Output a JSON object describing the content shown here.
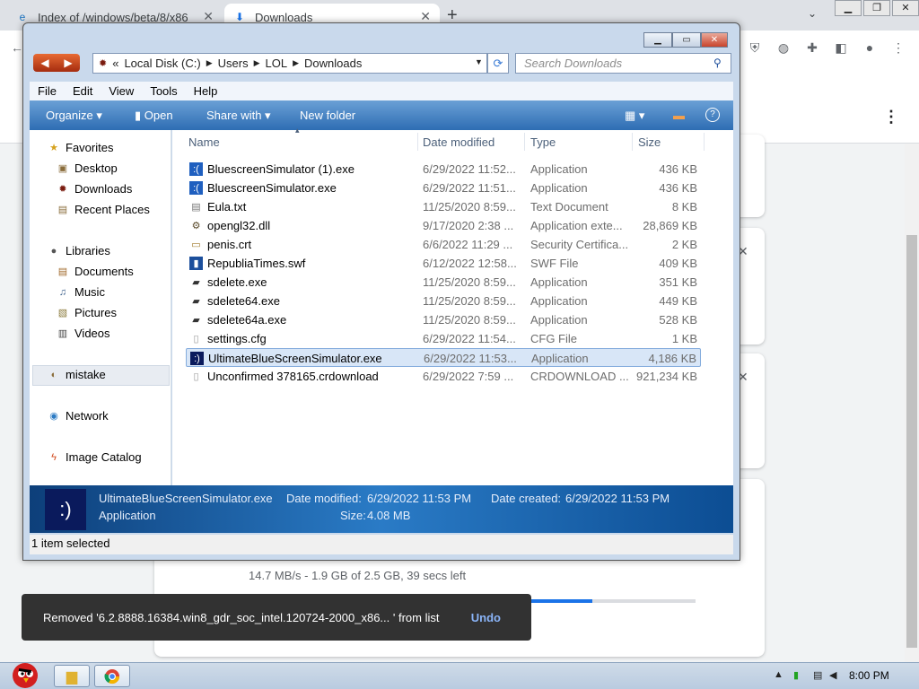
{
  "browser": {
    "tabs": [
      {
        "title": "Index of /windows/beta/8/x86"
      },
      {
        "title": "Downloads"
      }
    ],
    "new_tab_symbol": "+",
    "window_buttons": [
      "▁",
      "❐",
      "✕"
    ]
  },
  "downloads_page": {
    "progress_text": "14.7 MB/s - 1.9 GB of 2.5 GB, 39 secs left",
    "progress_fraction": 0.55,
    "snackbar": {
      "message": "Removed '6.2.8888.16384.win8_gdr_soc_intel.120724-2000_x86... ' from list",
      "action": "Undo"
    }
  },
  "explorer": {
    "breadcrumb": {
      "prefix": "«",
      "parts": [
        "Local Disk (C:)",
        "Users",
        "LOL",
        "Downloads"
      ]
    },
    "search_placeholder": "Search Downloads",
    "menu": [
      "File",
      "Edit",
      "View",
      "Tools",
      "Help"
    ],
    "commands": [
      "Organize",
      "Open",
      "Share with",
      "New folder"
    ],
    "nav": {
      "favorites": "Favorites",
      "favorite_items": [
        "Desktop",
        "Downloads",
        "Recent Places"
      ],
      "libraries": "Libraries",
      "library_items": [
        "Documents",
        "Music",
        "Pictures",
        "Videos"
      ],
      "homegroup": "mistake",
      "network": "Network",
      "catalog": "Image Catalog"
    },
    "columns": [
      "Name",
      "Date modified",
      "Type",
      "Size"
    ],
    "files": [
      {
        "name": "BluescreenSimulator (1).exe",
        "date": "6/29/2022 11:52...",
        "type": "Application",
        "size": "436 KB",
        "icon": "bluescreen-icon"
      },
      {
        "name": "BluescreenSimulator.exe",
        "date": "6/29/2022 11:51...",
        "type": "Application",
        "size": "436 KB",
        "icon": "bluescreen-icon"
      },
      {
        "name": "Eula.txt",
        "date": "11/25/2020 8:59...",
        "type": "Text Document",
        "size": "8 KB",
        "icon": "text-file-icon"
      },
      {
        "name": "opengl32.dll",
        "date": "9/17/2020 2:38 ...",
        "type": "Application exte...",
        "size": "28,869 KB",
        "icon": "dll-icon"
      },
      {
        "name": "penis.crt",
        "date": "6/6/2022 11:29 ...",
        "type": "Security Certifica...",
        "size": "2 KB",
        "icon": "certificate-icon"
      },
      {
        "name": "RepubliaTimes.swf",
        "date": "6/12/2022 12:58...",
        "type": "SWF File",
        "size": "409 KB",
        "icon": "swf-icon"
      },
      {
        "name": "sdelete.exe",
        "date": "11/25/2020 8:59...",
        "type": "Application",
        "size": "351 KB",
        "icon": "app-icon"
      },
      {
        "name": "sdelete64.exe",
        "date": "11/25/2020 8:59...",
        "type": "Application",
        "size": "449 KB",
        "icon": "app-icon"
      },
      {
        "name": "sdelete64a.exe",
        "date": "11/25/2020 8:59...",
        "type": "Application",
        "size": "528 KB",
        "icon": "app-icon"
      },
      {
        "name": "settings.cfg",
        "date": "6/29/2022 11:54...",
        "type": "CFG File",
        "size": "1 KB",
        "icon": "file-icon"
      },
      {
        "name": "UltimateBlueScreenSimulator.exe",
        "date": "6/29/2022 11:53...",
        "type": "Application",
        "size": "4,186 KB",
        "icon": "bluescreen-icon",
        "selected": true
      },
      {
        "name": "Unconfirmed 378165.crdownload",
        "date": "6/29/2022 7:59 ...",
        "type": "CRDOWNLOAD ...",
        "size": "921,234 KB",
        "icon": "file-icon"
      }
    ],
    "details": {
      "name": "UltimateBlueScreenSimulator.exe",
      "type": "Application",
      "modified_label": "Date modified:",
      "modified": "6/29/2022 11:53 PM",
      "created_label": "Date created:",
      "created": "6/29/2022 11:53 PM",
      "size_label": "Size:",
      "size": "4.08 MB",
      "thumb_text": ":)"
    },
    "status": "1 item selected"
  },
  "taskbar": {
    "clock": "8:00 PM"
  },
  "colors": {
    "command_bar": "#2e6db3",
    "selection": "#d8e6f7",
    "snackbar": "#323232",
    "undo": "#8ab4f8",
    "progress": "#1a73e8"
  }
}
